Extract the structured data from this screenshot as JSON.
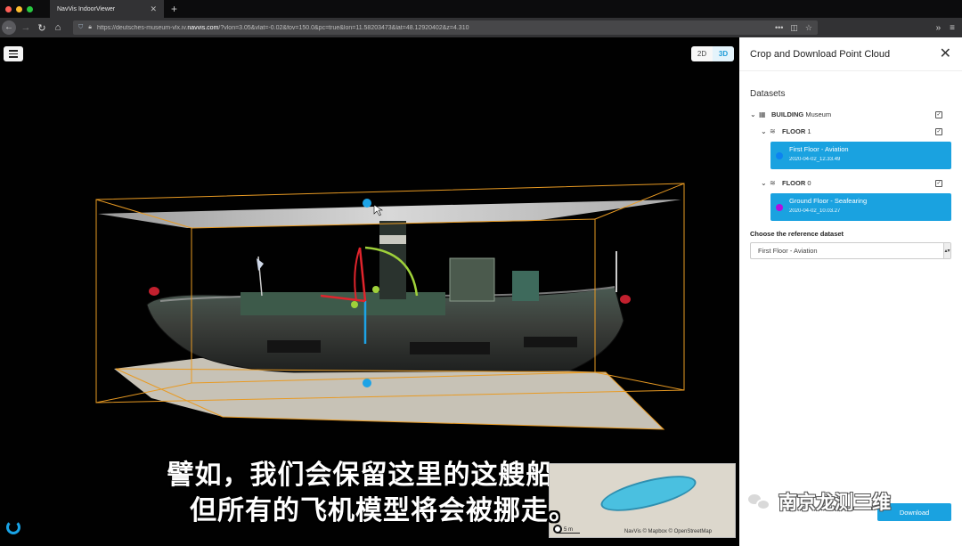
{
  "browser": {
    "tab_title": "NavVis IndoorViewer",
    "url_prefix": "https://deutsches-museum-vlx.iv.",
    "url_domain": "navvis.com",
    "url_rest": "/?vlon=3.05&vlat=-0.02&fov=150.0&pc=true&lon=11.58203473&lat=48.12920402&z=4.310"
  },
  "viewer": {
    "mode_2d": "2D",
    "mode_3d": "3D"
  },
  "panel": {
    "title": "Crop and Download Point Cloud",
    "datasets_label": "Datasets",
    "building": {
      "tag": "BUILDING",
      "name": "Museum"
    },
    "floors": [
      {
        "tag": "FLOOR",
        "number": "1",
        "dataset": {
          "name": "First Floor - Aviation",
          "timestamp": "2020-04-02_12.33.49",
          "color": "#0d83f0"
        }
      },
      {
        "tag": "FLOOR",
        "number": "0",
        "dataset": {
          "name": "Ground Floor - Seafearing",
          "timestamp": "2020-04-02_10.03.27",
          "color": "#b20ee0"
        }
      }
    ],
    "reference_label": "Choose the reference dataset",
    "reference_value": "First Floor - Aviation",
    "download_label": "Download"
  },
  "subtitles": {
    "line1": "譬如，我们会保留这里的这艘船，",
    "line2": "但所有的飞机模型将会被挪走。"
  },
  "minimap": {
    "scale": "5 m",
    "attribution": "NavVis © Mapbox © OpenStreetMap"
  },
  "watermark": "南京龙测三维",
  "colors": {
    "accent": "#1aa2e0",
    "crop_box": "#e89a23"
  }
}
